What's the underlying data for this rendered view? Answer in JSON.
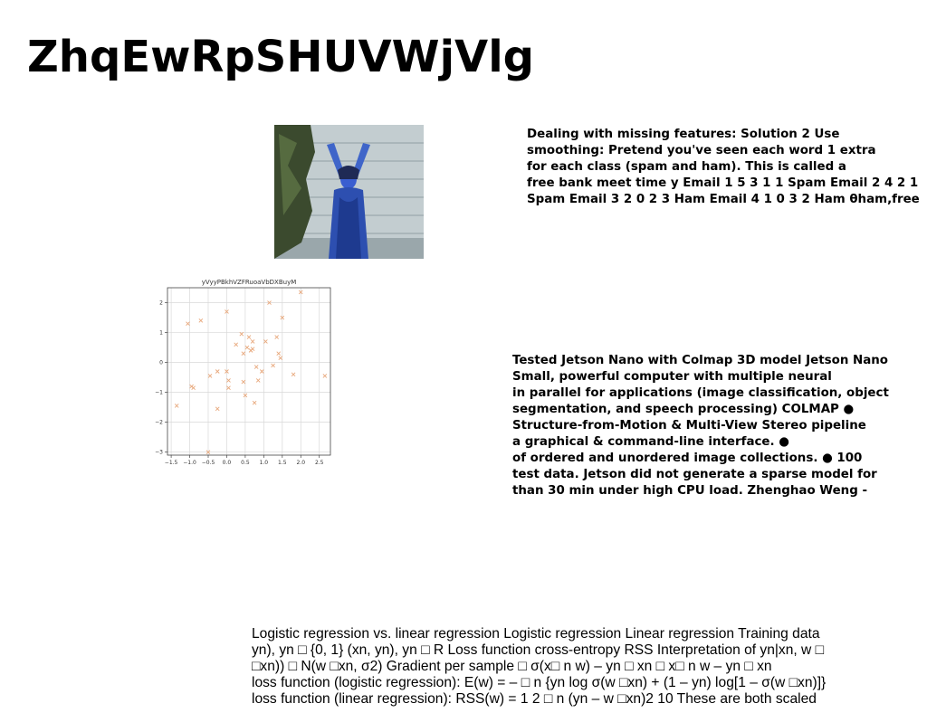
{
  "slide": {
    "title": "ZhqEwRpSHUVWjVlg",
    "text_block_1": "Dealing with missing features: Solution 2 Use\nsmoothing: Pretend you've seen each word 1 extra\nfor each class (spam and ham). This is called a\nfree bank meet time y Email 1 5 3 1 1 Spam Email 2 4 2 1\nSpam Email 3 2 0 2 3 Ham Email 4 1 0 3 2 Ham θham,free",
    "text_block_2": "Tested Jetson Nano with Colmap 3D model Jetson Nano\nSmall, powerful computer with multiple neural\nin parallel for applications (image classification, object\nsegmentation, and speech processing) COLMAP ●\nStructure-from-Motion & Multi-View Stereo pipeline\na graphical & command-line interface. ●\nof ordered and unordered image collections. ● 100\ntest data. Jetson did not generate a sparse model for\nthan 30 min under high CPU load. Zhenghao Weng -",
    "text_block_3": "Logistic regression vs. linear regression Logistic regression Linear regression Training data\nyn), yn □ {0, 1} (xn, yn), yn □ R Loss function cross-entropy RSS Interpretation of yn|xn, w □\n□xn)) □ N(w □xn, σ2) Gradient per sample □ σ(x□ n w) – yn □ xn □ x□ n w – yn □ xn\nloss function (logistic regression): E(w) = – □ n {yn log σ(w □xn) + (1 – yn) log[1 – σ(w □xn)]}\nloss function (linear regression): RSS(w) = 1 2 □ n (yn – w □xn)2 10 These are both scaled"
  },
  "chart_data": {
    "type": "scatter",
    "title": "yVyyPBkhVZFRuoaVbDXBuyM",
    "xlabel": "",
    "ylabel": "",
    "xlim": [
      -1.6,
      2.8
    ],
    "ylim": [
      -3.1,
      2.5
    ],
    "xticks": [
      "−1.5",
      "−1.0",
      "−0.5",
      "0.0",
      "0.5",
      "1.0",
      "1.5",
      "2.0",
      "2.5"
    ],
    "xtick_values": [
      -1.5,
      -1.0,
      -0.5,
      0.0,
      0.5,
      1.0,
      1.5,
      2.0,
      2.5
    ],
    "yticks": [
      "−3",
      "−2",
      "−1",
      "0",
      "1",
      "2"
    ],
    "ytick_values": [
      -3,
      -2,
      -1,
      0,
      1,
      2
    ],
    "grid": true,
    "marker": "x",
    "color": "#e8a87c",
    "points": [
      [
        -1.35,
        -1.45
      ],
      [
        -1.05,
        1.3
      ],
      [
        -0.95,
        -0.8
      ],
      [
        -0.9,
        -0.85
      ],
      [
        -0.7,
        1.4
      ],
      [
        -0.5,
        -3.0
      ],
      [
        -0.45,
        -0.45
      ],
      [
        -0.25,
        -0.3
      ],
      [
        -0.25,
        -1.55
      ],
      [
        0.0,
        1.7
      ],
      [
        0.0,
        -0.3
      ],
      [
        0.05,
        -0.6
      ],
      [
        0.05,
        -0.85
      ],
      [
        0.25,
        0.6
      ],
      [
        0.4,
        0.95
      ],
      [
        0.45,
        0.3
      ],
      [
        0.45,
        -0.65
      ],
      [
        0.5,
        -1.1
      ],
      [
        0.55,
        0.5
      ],
      [
        0.6,
        0.85
      ],
      [
        0.65,
        0.4
      ],
      [
        0.7,
        0.7
      ],
      [
        0.7,
        0.45
      ],
      [
        0.75,
        -1.35
      ],
      [
        0.8,
        -0.15
      ],
      [
        0.85,
        -0.6
      ],
      [
        0.95,
        -0.3
      ],
      [
        1.05,
        0.7
      ],
      [
        1.15,
        2.0
      ],
      [
        1.25,
        -0.1
      ],
      [
        1.35,
        0.85
      ],
      [
        1.4,
        0.3
      ],
      [
        1.45,
        0.15
      ],
      [
        1.5,
        1.5
      ],
      [
        1.8,
        -0.4
      ],
      [
        2.0,
        2.35
      ],
      [
        2.65,
        -0.45
      ]
    ]
  },
  "photo": {
    "description_icon": "woman-photo",
    "colors": {
      "wall": "#b9c4c8",
      "dress": "#2d4fb0",
      "foliage": "#3b4a2e",
      "floor": "#9aa7ab"
    }
  }
}
